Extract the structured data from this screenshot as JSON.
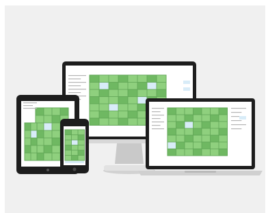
{
  "image": {
    "subject": "responsive-calendar-app",
    "devices": [
      "desktop-monitor",
      "tablet",
      "smartphone",
      "laptop"
    ],
    "colors": {
      "backdrop": "#f0f0f0",
      "device_frame": "#1d1d1d",
      "calendar_cell": "#8fd07e",
      "calendar_cell_dark": "#6fb862",
      "calendar_highlight": "#d8ecf8",
      "calendar_border": "#5fa456",
      "stand_silver": "#c9c9c9",
      "screen_bg": "#ffffff"
    }
  }
}
